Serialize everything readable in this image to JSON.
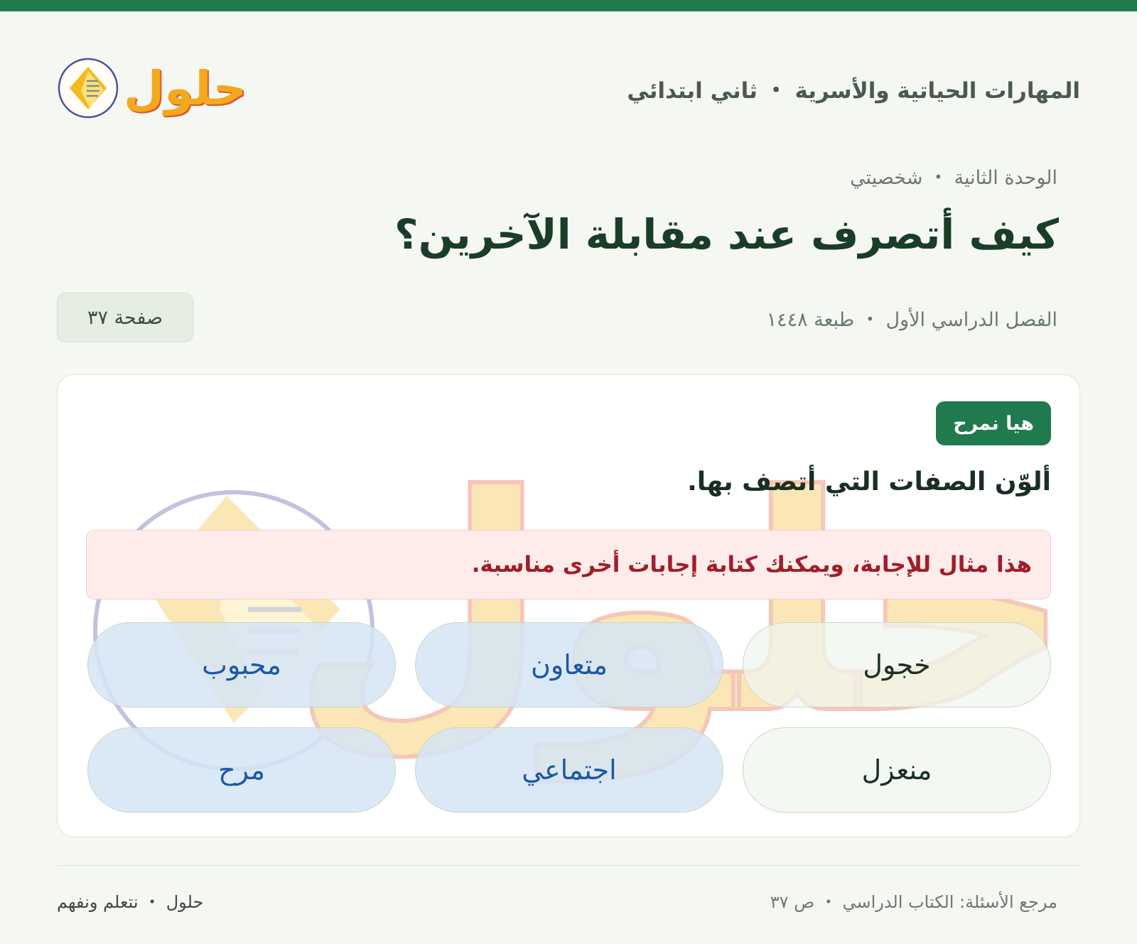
{
  "header": {
    "subject_title": "المهارات الحياتية والأسرية ・ ثاني ابتدائي",
    "logo_text": "حلول"
  },
  "lesson": {
    "unit": "الوحدة الثانية ・ شخصيتي",
    "title": "كيف أتصرف عند مقابلة الآخرين؟",
    "term": "الفصل الدراسي الأول ・ طبعة ١٤٤٨",
    "page_badge": "صفحة ٣٧"
  },
  "activity": {
    "badge": "هيا نمرح",
    "question": "ألوّن الصفات التي أتصف بها.",
    "note": "هذا مثال للإجابة، ويمكنك كتابة إجابات أخرى مناسبة.",
    "options": [
      {
        "label": "خجول",
        "selected": false
      },
      {
        "label": "متعاون",
        "selected": true
      },
      {
        "label": "محبوب",
        "selected": true
      },
      {
        "label": "منعزل",
        "selected": false
      },
      {
        "label": "اجتماعي",
        "selected": true
      },
      {
        "label": "مرح",
        "selected": true
      }
    ]
  },
  "footer": {
    "reference": "مرجع الأسئلة: الكتاب الدراسي ・ ص ٣٧",
    "brand": "حلول ・ نتعلم ونفهم"
  },
  "colors": {
    "brand_green": "#1f7a4d",
    "selected_fill": "#d5e5f6",
    "selected_text": "#1c57a5",
    "note_text": "#a11d2a",
    "logo_orange": "#f2a91e"
  }
}
